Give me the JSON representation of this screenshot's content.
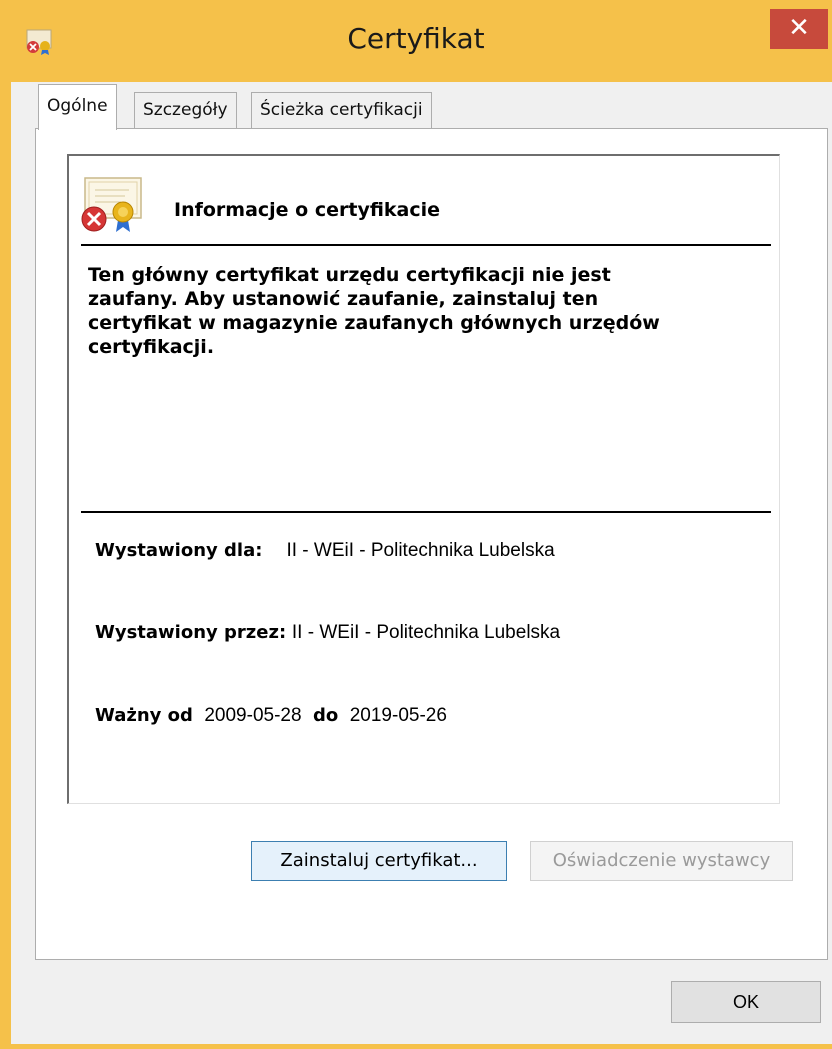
{
  "window": {
    "title": "Certyfikat",
    "close_glyph": "✕",
    "app_icon": "certificate-error-icon",
    "accent": "#f5c14a",
    "close_color": "#c74a3c"
  },
  "tabs": [
    {
      "label": "Ogólne",
      "active": true
    },
    {
      "label": "Szczegóły",
      "active": false
    },
    {
      "label": "Ścieżka certyfikacji",
      "active": false
    }
  ],
  "info": {
    "icon": "certificate-error-icon",
    "heading": "Informacje o certyfikacie",
    "warning_lines": [
      "Ten główny certyfikat urzędu certyfikacji nie jest",
      "zaufany. Aby ustanowić zaufanie, zainstaluj ten",
      "certyfikat w magazynie zaufanych głównych urzędów",
      "certyfikacji."
    ],
    "issued_to_label": "Wystawiony dla:",
    "issued_to_value": "II - WEiI - Politechnika Lubelska",
    "issued_by_label": "Wystawiony przez:",
    "issued_by_value": "II - WEiI - Politechnika Lubelska",
    "valid_from_label": "Ważny od",
    "valid_from_value": "2009-05-28",
    "valid_to_label": "do",
    "valid_to_value": "2019-05-26"
  },
  "buttons": {
    "install": "Zainstaluj certyfikat...",
    "issuer_statement": "Oświadczenie wystawcy",
    "ok": "OK"
  }
}
